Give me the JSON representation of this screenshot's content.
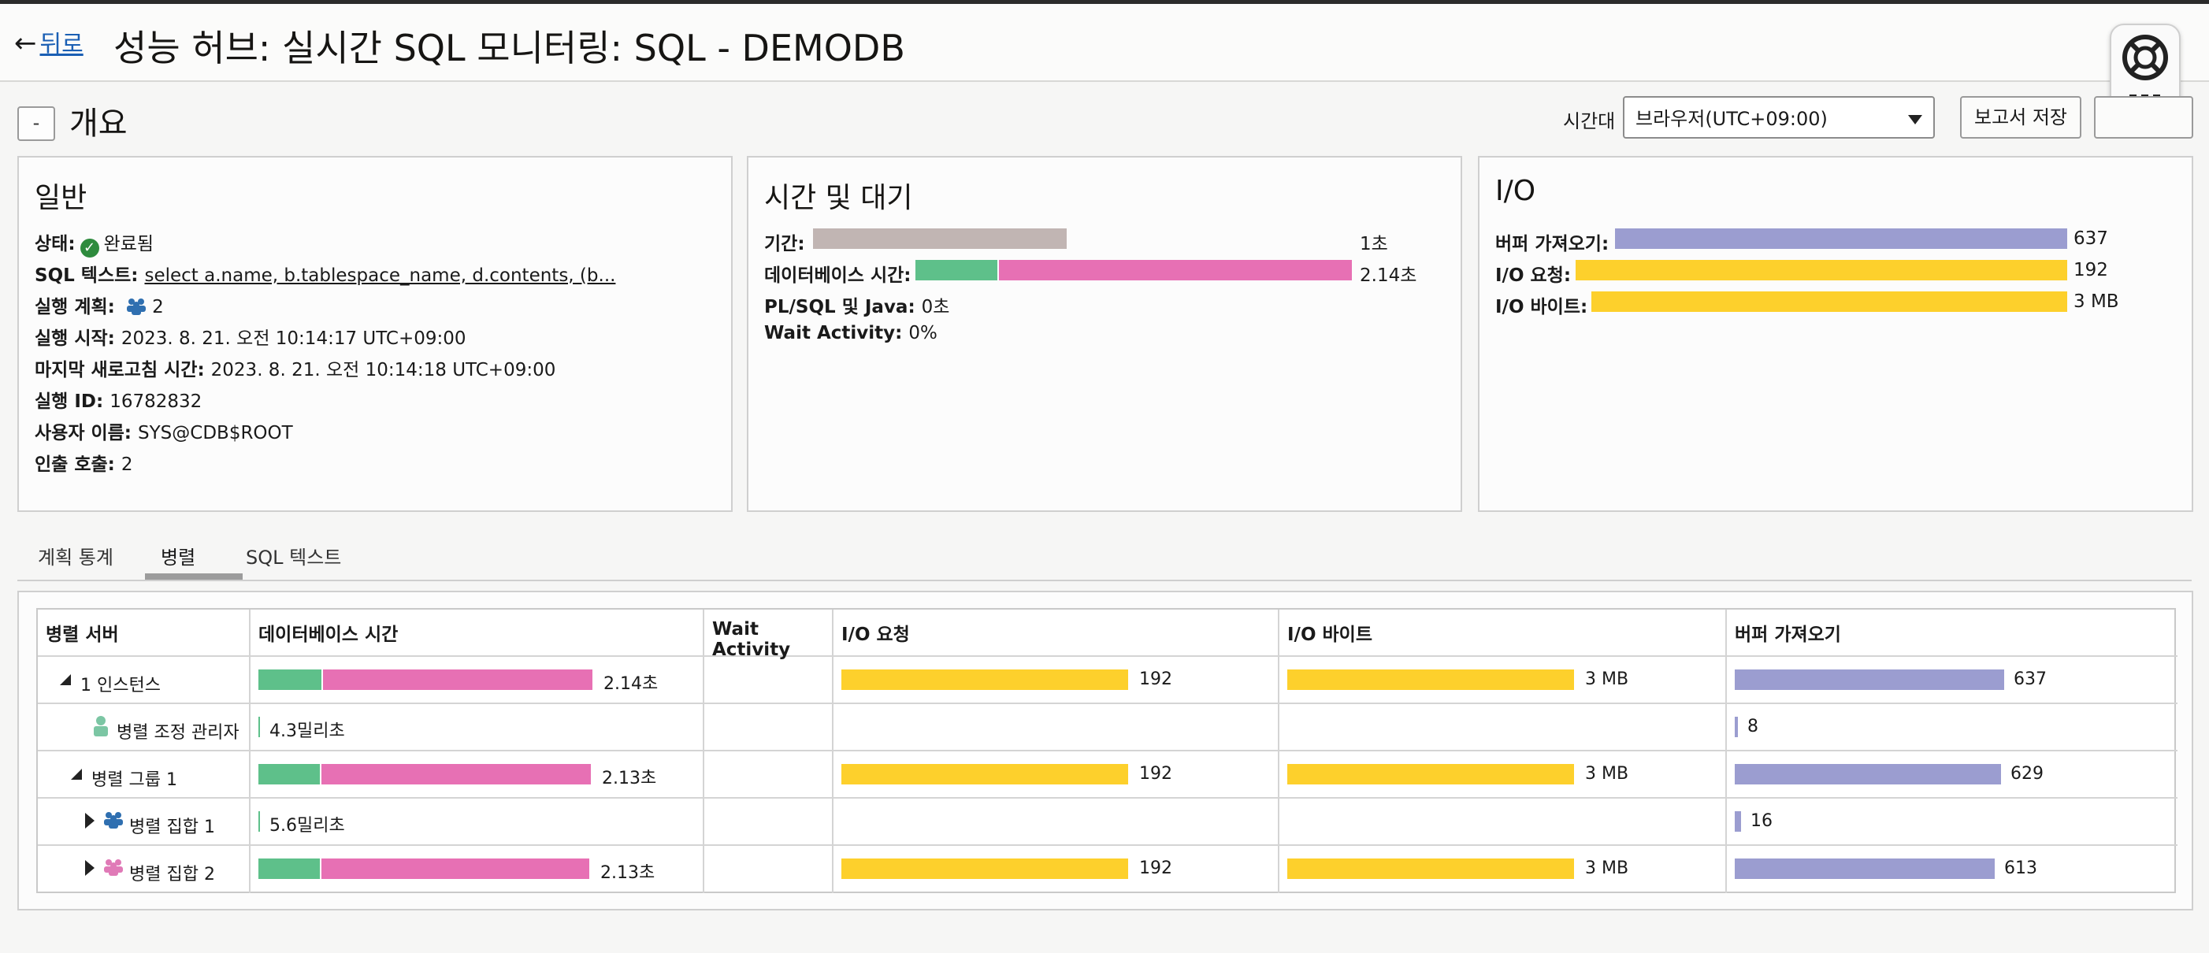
{
  "header": {
    "back_arrow": "←",
    "back_label": "뒤로",
    "title": "성능 허브: 실시간 SQL 모니터링: SQL - DEMODB"
  },
  "overview": {
    "collapse_label": "-",
    "title": "개요",
    "timezone_label": "시간대",
    "timezone_value": "브라우저(UTC+09:00)",
    "save_report_label": "보고서 저장"
  },
  "general": {
    "title": "일반",
    "status_label": "상태:",
    "status_value": "완료됨",
    "sql_text_label": "SQL 텍스트:",
    "sql_text_value": "select a.name, b.tablespace_name, d.contents, (b...",
    "plan_label": "실행 계획:",
    "plan_value": "2",
    "start_label": "실행 시작:",
    "start_value": "2023. 8. 21. 오전 10:14:17 UTC+09:00",
    "refresh_label": "마지막 새로고침 시간:",
    "refresh_value": "2023. 8. 21. 오전 10:14:18 UTC+09:00",
    "exec_id_label": "실행 ID:",
    "exec_id_value": "16782832",
    "user_label": "사용자 이름:",
    "user_value": "SYS@CDB$ROOT",
    "fetch_label": "인출 호출:",
    "fetch_value": "2"
  },
  "time_wait": {
    "title": "시간 및 대기",
    "duration_label": "기간:",
    "duration_value": "1초",
    "db_time_label": "데이터베이스 시간:",
    "db_time_value": "2.14초",
    "plsql_label": "PL/SQL 및 Java:",
    "plsql_value": "0초",
    "wait_label": "Wait Activity:",
    "wait_value": "0%"
  },
  "io": {
    "title": "I/O",
    "buffer_label": "버퍼 가져오기:",
    "buffer_value": "637",
    "req_label": "I/O 요청:",
    "req_value": "192",
    "bytes_label": "I/O 바이트:",
    "bytes_value": "3 MB"
  },
  "tabs": [
    "계획 통계",
    "병렬",
    "SQL 텍스트"
  ],
  "active_tab": "병렬",
  "table": {
    "headers": [
      "병렬 서버",
      "데이터베이스 시간",
      "Wait Activity",
      "I/O 요청",
      "I/O 바이트",
      "버퍼 가져오기"
    ],
    "rows": [
      {
        "name": "1 인스턴스",
        "db_time": "2.14초",
        "io_req": "192",
        "io_bytes": "3 MB",
        "buffer": "637"
      },
      {
        "name": "병렬 조정 관리자",
        "db_time": "4.3밀리초",
        "io_req": "",
        "io_bytes": "",
        "buffer": "8"
      },
      {
        "name": "병렬 그룹 1",
        "db_time": "2.13초",
        "io_req": "192",
        "io_bytes": "3 MB",
        "buffer": "629"
      },
      {
        "name": "병렬 집합 1",
        "db_time": "5.6밀리초",
        "io_req": "",
        "io_bytes": "",
        "buffer": "16"
      },
      {
        "name": "병렬 집합 2",
        "db_time": "2.13초",
        "io_req": "192",
        "io_bytes": "3 MB",
        "buffer": "613"
      }
    ]
  },
  "colors": {
    "cpu": "#5ec08a",
    "user_io": "#e770b4",
    "io": "#fdd02c",
    "buffer": "#9b9dd0",
    "duration": "#c1b5b3"
  }
}
